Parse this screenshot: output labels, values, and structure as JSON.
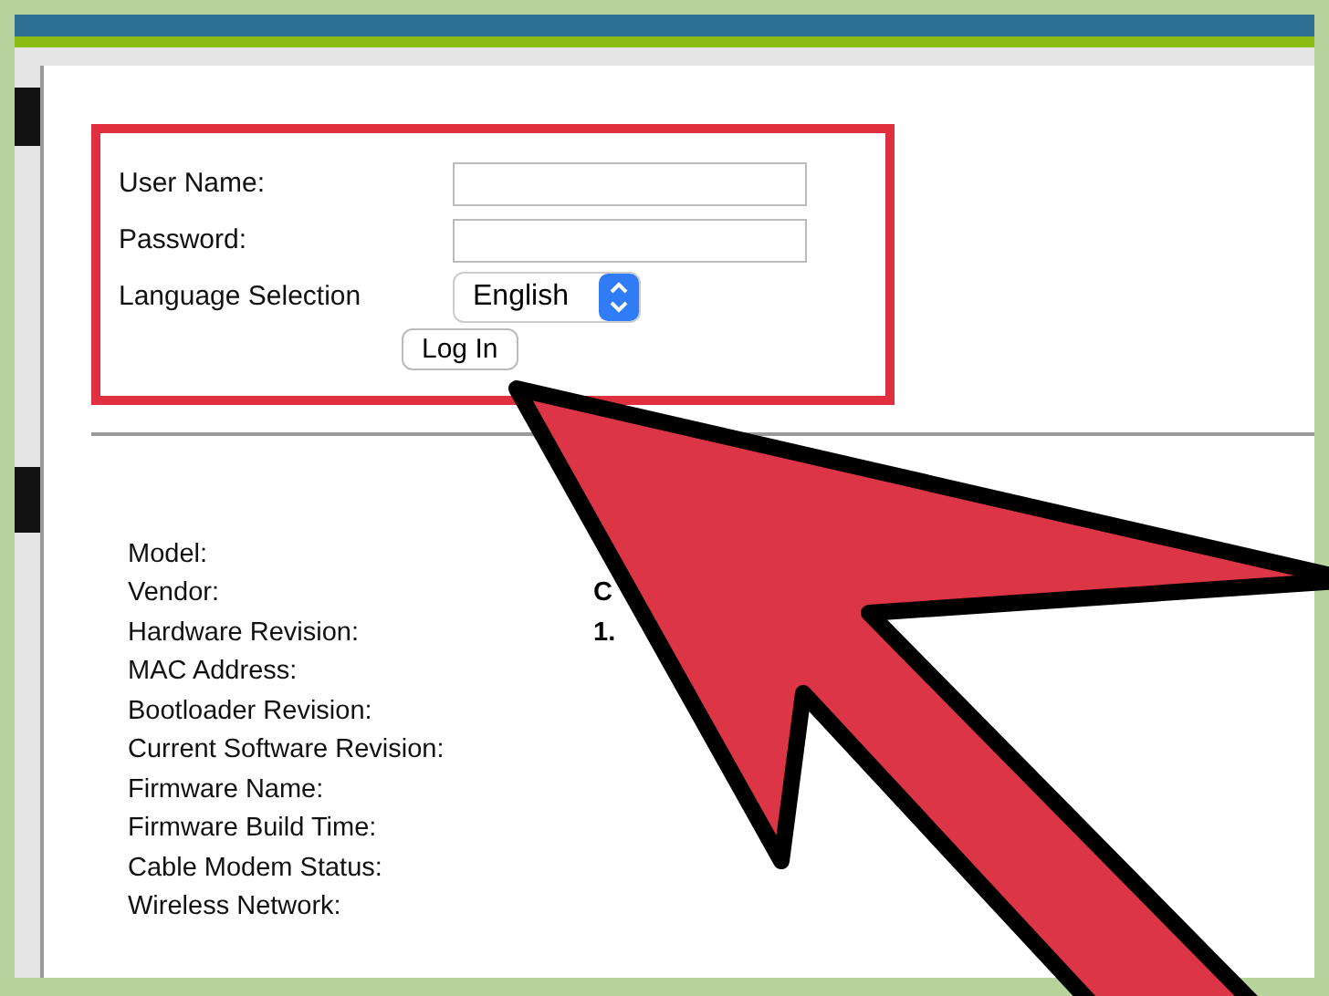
{
  "login": {
    "fields": [
      {
        "label": "User Name:"
      },
      {
        "label": "Password:"
      }
    ],
    "language": {
      "label": "Language Selection",
      "value": "English"
    },
    "button": "Log In"
  },
  "info": [
    {
      "label": "Model:"
    },
    {
      "label": "Vendor:",
      "value": "C"
    },
    {
      "label": "Hardware Revision:",
      "value": "1."
    },
    {
      "label": "MAC Address:"
    },
    {
      "label": "Bootloader Revision:"
    },
    {
      "label": "Current Software Revision:"
    },
    {
      "label": "Firmware Name:"
    },
    {
      "label": "Firmware Build Time:"
    },
    {
      "label": "Cable Modem Status:"
    },
    {
      "label": "Wireless Network:"
    }
  ]
}
